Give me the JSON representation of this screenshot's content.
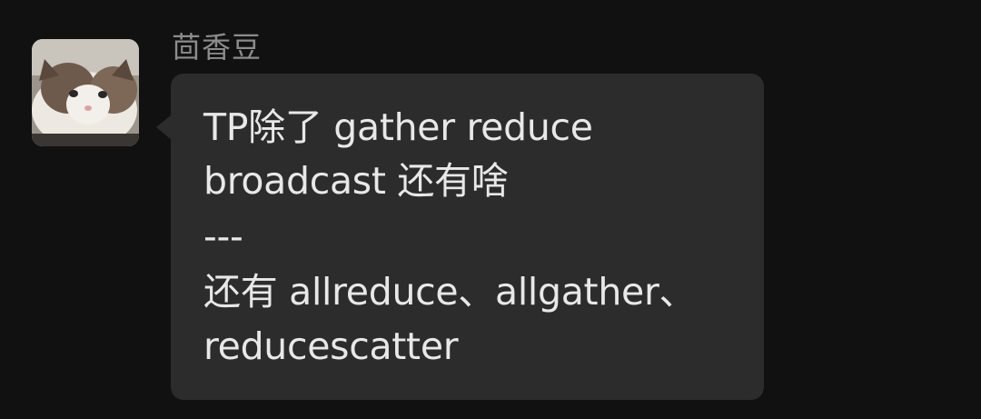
{
  "chat": {
    "sender_name": "茴香豆",
    "avatar_icon": "cat-avatar",
    "message": {
      "lines": [
        "TP除了 gather reduce",
        "broadcast 还有啥",
        "---",
        "还有 allreduce、allgather、",
        "reducescatter"
      ]
    }
  },
  "colors": {
    "background": "#111111",
    "bubble": "#2c2c2c",
    "text": "#e8e8e8",
    "sender": "#8c8c8c"
  }
}
